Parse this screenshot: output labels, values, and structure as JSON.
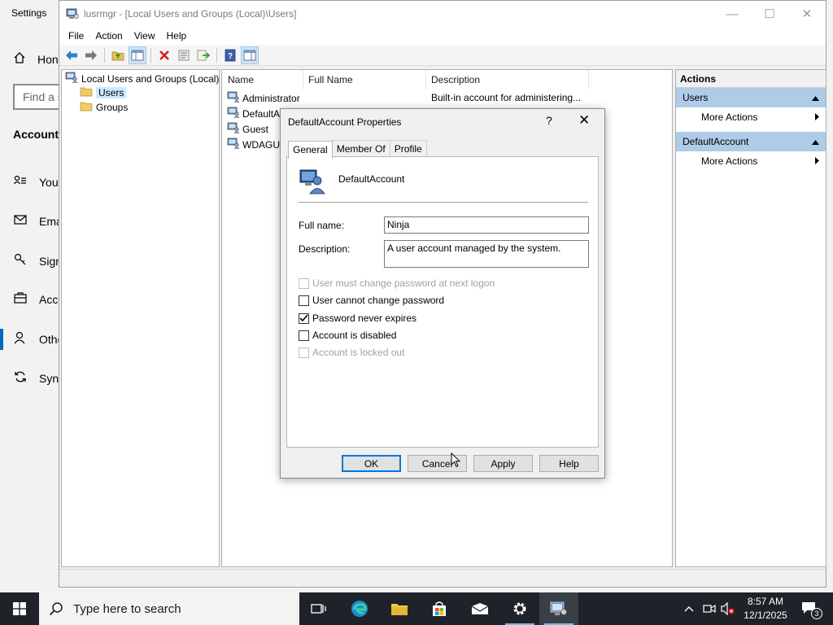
{
  "settings": {
    "title": "Settings",
    "home_label": "Hon",
    "search_placeholder": "Find a s",
    "section": "Accounts",
    "nav": [
      {
        "label": "You",
        "icon": "person-list-icon"
      },
      {
        "label": "Ema",
        "icon": "mail-icon"
      },
      {
        "label": "Sign",
        "icon": "key-icon"
      },
      {
        "label": "Acco",
        "icon": "briefcase-icon"
      },
      {
        "label": "Othe",
        "icon": "people-icon"
      },
      {
        "label": "Sync",
        "icon": "sync-icon"
      }
    ]
  },
  "mmc": {
    "title": "lusrmgr - [Local Users and Groups (Local)\\Users]",
    "menu": [
      "File",
      "Action",
      "View",
      "Help"
    ],
    "tree": {
      "root": "Local Users and Groups (Local)",
      "children": [
        "Users",
        "Groups"
      ]
    },
    "columns": [
      "Name",
      "Full Name",
      "Description"
    ],
    "users": [
      {
        "name": "Administrator",
        "full_name": "",
        "description": "Built-in account for administering..."
      },
      {
        "name": "DefaultAc",
        "full_name": "",
        "description": ""
      },
      {
        "name": "Guest",
        "full_name": "",
        "description": ""
      },
      {
        "name": "WDAGUti",
        "full_name": "",
        "description": ""
      }
    ],
    "actions": {
      "header": "Actions",
      "groups": [
        {
          "title": "Users",
          "item": "More Actions"
        },
        {
          "title": "DefaultAccount",
          "item": "More Actions"
        }
      ]
    }
  },
  "dialog": {
    "title": "DefaultAccount Properties",
    "help_glyph": "?",
    "tabs": [
      "General",
      "Member Of",
      "Profile"
    ],
    "account_name": "DefaultAccount",
    "full_name_label": "Full name:",
    "full_name_value": "Ninja",
    "description_label": "Description:",
    "description_value": "A user account managed by the system.",
    "checkboxes": [
      {
        "label": "User must change password at next logon",
        "checked": false,
        "enabled": false
      },
      {
        "label": "User cannot change password",
        "checked": false,
        "enabled": true
      },
      {
        "label": "Password never expires",
        "checked": true,
        "enabled": true
      },
      {
        "label": "Account is disabled",
        "checked": false,
        "enabled": true
      },
      {
        "label": "Account is locked out",
        "checked": false,
        "enabled": false
      }
    ],
    "buttons": {
      "ok": "OK",
      "cancel": "Cancel",
      "apply": "Apply",
      "help": "Help"
    }
  },
  "taskbar": {
    "search_placeholder": "Type here to search",
    "time": "8:57 AM",
    "date": "12/1/2025",
    "notification_count": "3"
  },
  "colors": {
    "accent": "#0078d7",
    "selection": "#cce8ff",
    "actions_group": "#aecbe8",
    "taskbar": "#1f2329"
  }
}
